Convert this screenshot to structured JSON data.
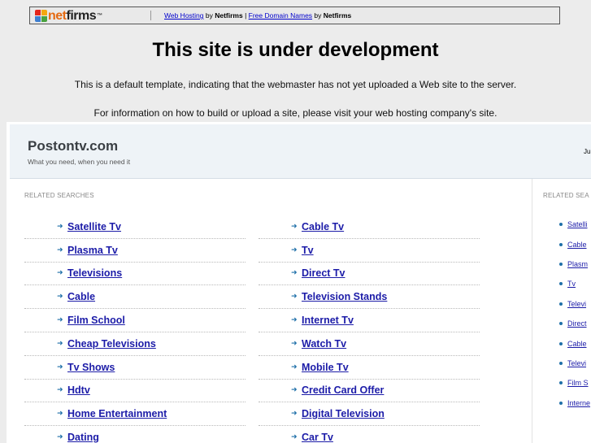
{
  "topbar": {
    "logo_net": "net",
    "logo_firms": "firms",
    "logo_tm": "™",
    "link_web_hosting": "Web Hosting",
    "by1": " by ",
    "brand1": "Netfirms",
    "separator": " | ",
    "link_free_domains": "Free Domain Names",
    "by2": " by ",
    "brand2": "Netfirms",
    "colors": {
      "net": "#e46a12",
      "firms": "#222222"
    }
  },
  "headline": "This site is under development",
  "info_line_1": "This is a default template, indicating that the webmaster has not yet uploaded a Web site to the server.",
  "info_line_2": "For information on how to build or upload a site, please visit your web hosting company's site.",
  "site": {
    "title": "Postontv.com",
    "tagline": "What you need, when you need it",
    "date_fragment": "Ju"
  },
  "main": {
    "section_label": "RELATED SEARCHES",
    "col1": [
      "Satellite Tv",
      "Plasma Tv",
      "Televisions",
      "Cable",
      "Film School",
      "Cheap Televisions",
      "Tv Shows",
      "Hdtv",
      "Home Entertainment",
      "Dating"
    ],
    "col2": [
      "Cable Tv",
      "Tv",
      "Direct Tv",
      "Television Stands",
      "Internet Tv",
      "Watch Tv",
      "Mobile Tv",
      "Credit Card Offer",
      "Digital Television",
      "Car Tv"
    ],
    "arrow_glyph": "➜",
    "link_color": "#1c1ca8"
  },
  "side": {
    "section_label": "RELATED SEA",
    "items": [
      "Satelli",
      "Cable",
      "Plasm",
      "Tv",
      "Televi",
      "Direct",
      "Cable",
      "Televi",
      "Film S",
      "Interne"
    ]
  }
}
